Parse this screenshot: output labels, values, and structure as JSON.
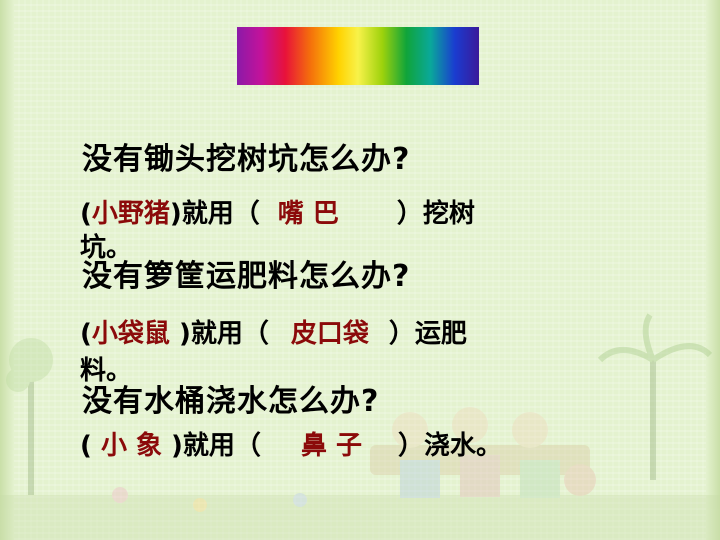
{
  "colors": {
    "background": "#e4f2cf",
    "text": "#000000",
    "answer": "#8b0a0a"
  },
  "questions": [
    {
      "question": "没有锄头挖树坑怎么办?",
      "open": "(",
      "animal": "小野猪",
      "close_used": ")就用（",
      "answer": "嘴  巴",
      "tail": "）挖树",
      "wrap": "坑。"
    },
    {
      "question": "没有箩筐运肥料怎么办?",
      "open": "(",
      "animal": "小袋鼠 ",
      "close_used": ")就用（",
      "answer": "皮口袋",
      "tail": "）运肥",
      "wrap": "料。"
    },
    {
      "question": "没有水桶浇水怎么办?",
      "open": "( ",
      "animal": "小  象 ",
      "close_used": ")就用（",
      "answer": "鼻  子",
      "tail": "）浇水。",
      "wrap": ""
    }
  ],
  "decorations": {
    "banner": "rainbow-banner",
    "scene": "children-cartoon-scene"
  }
}
